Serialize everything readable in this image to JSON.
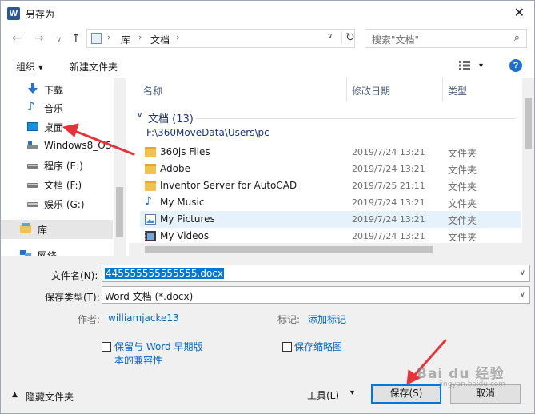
{
  "window": {
    "title": "另存为",
    "app_icon": "word-icon",
    "close": "✕"
  },
  "nav": {
    "back": "←",
    "forward": "→",
    "recent": "∨",
    "up": "↑"
  },
  "address": {
    "crumbs": [
      "库",
      "文档"
    ],
    "sep": "›",
    "dropdown": "∨",
    "refresh": "↻"
  },
  "search": {
    "placeholder": "搜索\"文档\""
  },
  "toolbar": {
    "organize": "组织 ▾",
    "new_folder": "新建文件夹",
    "view": "▾",
    "help": "?"
  },
  "sidebar": {
    "items": [
      {
        "label": "下载",
        "icon": "download-icon"
      },
      {
        "label": "音乐",
        "icon": "music-icon"
      },
      {
        "label": "桌面",
        "icon": "desktop-icon"
      },
      {
        "label": "Windows8_OS",
        "icon": "drive-icon"
      },
      {
        "label": "程序 (E:)",
        "icon": "drive-icon"
      },
      {
        "label": "文档 (F:)",
        "icon": "drive-icon"
      },
      {
        "label": "娱乐 (G:)",
        "icon": "drive-icon"
      },
      {
        "label": "库",
        "icon": "library-icon"
      },
      {
        "label": "网络",
        "icon": "network-icon"
      }
    ]
  },
  "filelist": {
    "columns": {
      "name": "名称",
      "date": "修改日期",
      "type": "类型"
    },
    "group": {
      "title": "文档 (13)",
      "path": "F:\\360MoveData\\Users\\pc",
      "chevron": "∨"
    },
    "rows": [
      {
        "name": "360js Files",
        "date": "2019/7/24 13:21",
        "type": "文件夹"
      },
      {
        "name": "Adobe",
        "date": "2019/7/24 13:21",
        "type": "文件夹"
      },
      {
        "name": "Inventor Server for AutoCAD",
        "date": "2019/7/25 21:11",
        "type": "文件夹"
      },
      {
        "name": "My Music",
        "date": "2019/7/24 13:21",
        "type": "文件夹"
      },
      {
        "name": "My Pictures",
        "date": "2019/7/24 13:21",
        "type": "文件夹"
      },
      {
        "name": "My Videos",
        "date": "2019/7/24 13:21",
        "type": "文件夹"
      }
    ]
  },
  "form": {
    "filename_label": "文件名(N):",
    "filename_value": "445555555555555.docx",
    "filetype_label": "保存类型(T):",
    "filetype_value": "Word 文档 (*.docx)",
    "author_label": "作者:",
    "author_value": "williamjacke13",
    "tags_label": "标记:",
    "tags_value": "添加标记",
    "compat_line1": "保留与 Word 早期版",
    "compat_line2": "本的兼容性",
    "thumbnail": "保存缩略图"
  },
  "footer": {
    "hide_folders": "隐藏文件夹",
    "tools": "工具(L)",
    "save": "保存(S)",
    "cancel": "取消"
  },
  "watermark": {
    "text": "Bai du 经验",
    "sub": "jingyan.baidu.com"
  },
  "colors": {
    "accent": "#0078d7",
    "annotation": "#e8323a",
    "folder": "#f1c34e"
  }
}
